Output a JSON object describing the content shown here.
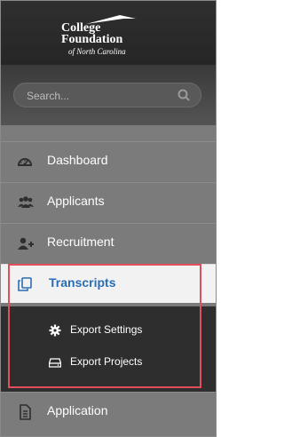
{
  "header": {
    "logo_line1": "College",
    "logo_line2": "Foundation",
    "logo_line3": "of North Carolina"
  },
  "search": {
    "placeholder": "Search..."
  },
  "menu": {
    "dashboard": "Dashboard",
    "applicants": "Applicants",
    "recruitment": "Recruitment",
    "transcripts": "Transcripts",
    "application": "Application"
  },
  "submenu": {
    "export_settings": "Export Settings",
    "export_projects": "Export Projects"
  },
  "colors": {
    "active_text": "#2a6db5",
    "highlight": "#e04f5a",
    "submenu_bg": "#2e2e2e"
  }
}
